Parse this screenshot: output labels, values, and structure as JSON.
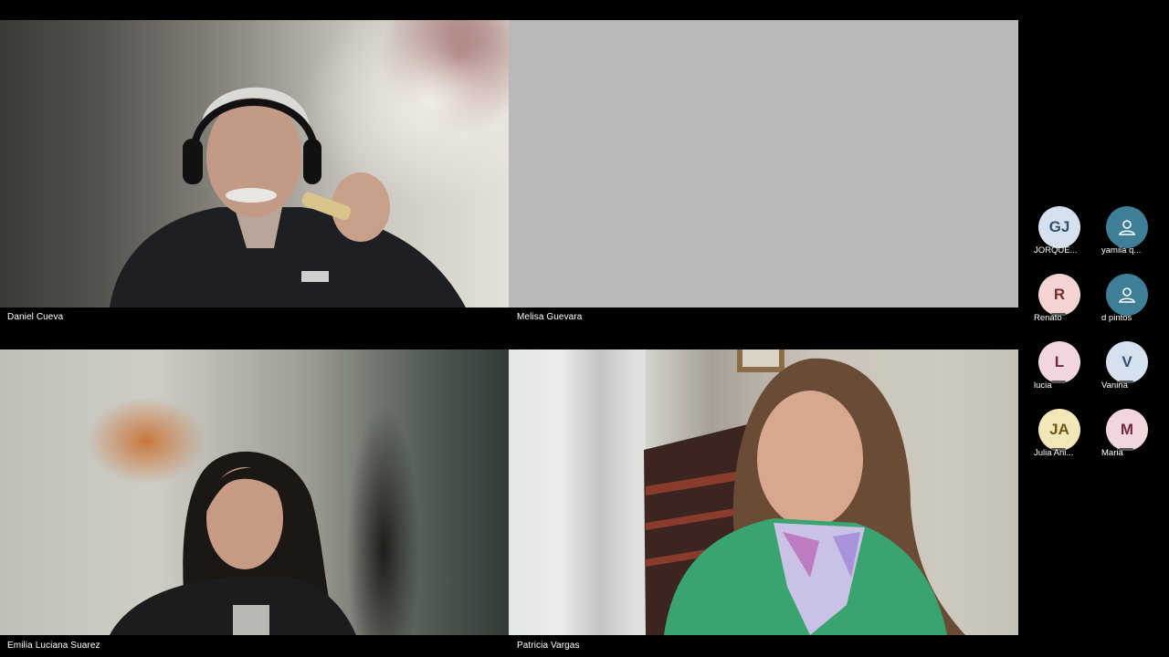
{
  "tiles": [
    {
      "name": "Daniel Cueva",
      "camera_on": true
    },
    {
      "name": "Melisa Guevara",
      "camera_on": false
    },
    {
      "name": "Emilia Luciana Suarez",
      "camera_on": true
    },
    {
      "name": "Patricia Vargas",
      "camera_on": true
    }
  ],
  "participants": [
    {
      "initials": "GJ",
      "name": "JORQUE...",
      "avatar_bg": "#d5e1ee",
      "avatar_fg": "#35506e"
    },
    {
      "initials": "",
      "name": "yamila q...",
      "avatar_bg": "#3e7f97",
      "avatar_fg": "#ffffff",
      "icon": "person-icon"
    },
    {
      "initials": "R",
      "name": "Renato",
      "avatar_bg": "#f4d3d3",
      "avatar_fg": "#7a2f2f"
    },
    {
      "initials": "",
      "name": "d pintos",
      "avatar_bg": "#3e7f97",
      "avatar_fg": "#ffffff",
      "icon": "person-icon"
    },
    {
      "initials": "L",
      "name": "lucia",
      "avatar_bg": "#f2d6de",
      "avatar_fg": "#6e2a3e"
    },
    {
      "initials": "V",
      "name": "Vanina",
      "avatar_bg": "#d5e1ee",
      "avatar_fg": "#35506e"
    },
    {
      "initials": "JA",
      "name": "Julia Ani...",
      "avatar_bg": "#f2e7b8",
      "avatar_fg": "#6b5a14"
    },
    {
      "initials": "M",
      "name": "Maria",
      "avatar_bg": "#f2d6de",
      "avatar_fg": "#6e2a3e"
    }
  ]
}
